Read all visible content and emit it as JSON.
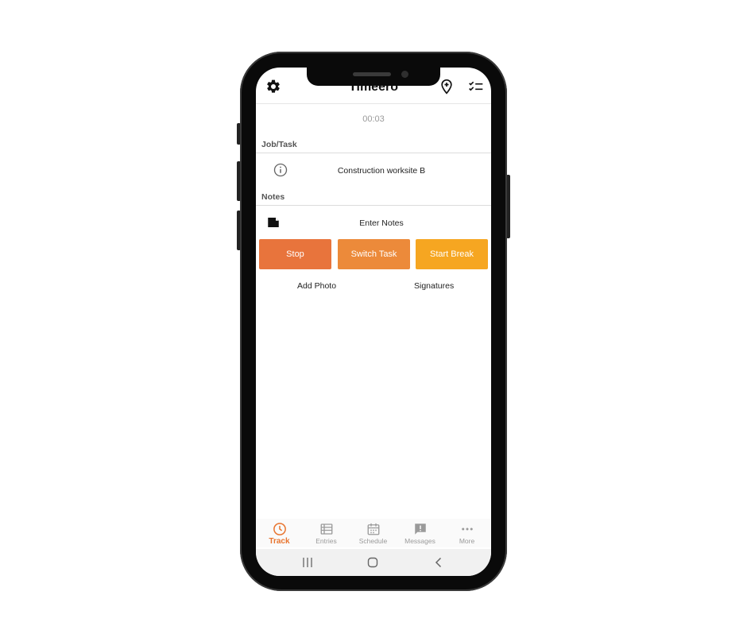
{
  "header": {
    "title": "Timeero",
    "icons": [
      "gear-icon",
      "add-location-icon",
      "checklist-icon"
    ]
  },
  "timer": "00:03",
  "job_task": {
    "label": "Job/Task",
    "value": "Construction worksite B",
    "icon": "info-icon"
  },
  "notes": {
    "label": "Notes",
    "placeholder": "Enter Notes",
    "icon": "note-icon"
  },
  "actions": [
    {
      "label": "Stop",
      "color": "#e8743c"
    },
    {
      "label": "Switch Task",
      "color": "#ec8a3a"
    },
    {
      "label": "Start Break",
      "color": "#f6a621"
    }
  ],
  "links": {
    "add_photo": "Add Photo",
    "signatures": "Signatures"
  },
  "bottom_nav": [
    {
      "label": "Track",
      "icon": "clock-icon",
      "active": true
    },
    {
      "label": "Entries",
      "icon": "list-icon",
      "active": false
    },
    {
      "label": "Schedule",
      "icon": "calendar-icon",
      "active": false
    },
    {
      "label": "Messages",
      "icon": "message-icon",
      "active": false
    },
    {
      "label": "More",
      "icon": "more-icon",
      "active": false
    }
  ],
  "colors": {
    "accent": "#e8742e",
    "inactive": "#9a9a9a"
  }
}
